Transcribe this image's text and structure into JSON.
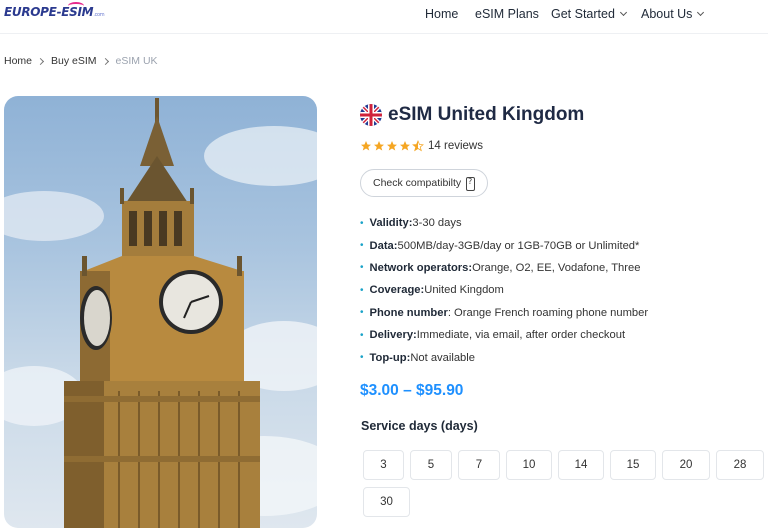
{
  "header": {
    "logo_text": "EUROPE-ESIM",
    "logo_tld": ".com",
    "nav": [
      {
        "label": "Home",
        "has_dropdown": false
      },
      {
        "label": "eSIM Plans",
        "has_dropdown": false
      },
      {
        "label": "Get Started",
        "has_dropdown": true
      },
      {
        "label": "About Us",
        "has_dropdown": true
      }
    ]
  },
  "breadcrumb": [
    "Home",
    "Buy eSIM",
    "eSIM UK"
  ],
  "product": {
    "image_icon": "big-ben-photo",
    "flag_icon": "uk-flag-icon",
    "title": "eSIM United Kingdom",
    "rating": 4.5,
    "reviews": "14 reviews",
    "check_button": "Check compatibilty",
    "specs": [
      {
        "key": "Validity:",
        "value": " 3-30 days"
      },
      {
        "key": "Data:",
        "value": " 500MB/day-3GB/day or 1GB-70GB or Unlimited*"
      },
      {
        "key": "Network operators:",
        "value": " Orange, O2, EE, Vodafone, Three"
      },
      {
        "key": "Coverage:",
        "value": " United Kingdom"
      },
      {
        "key": "Phone number",
        "value": ": Orange French roaming phone number"
      },
      {
        "key": "Delivery:",
        "value": " Immediate, via email, after order checkout"
      },
      {
        "key": "Top-up:",
        "value": " Not available"
      }
    ],
    "price": "$3.00 – $95.90",
    "days_heading": "Service days (days)",
    "days": [
      "3",
      "5",
      "7",
      "10",
      "14",
      "15",
      "20",
      "28",
      "30"
    ]
  },
  "colors": {
    "accent": "#1e90ff",
    "bullet": "#1aa3c8",
    "star": "#f5a623",
    "logo": "#2b3a8f"
  }
}
